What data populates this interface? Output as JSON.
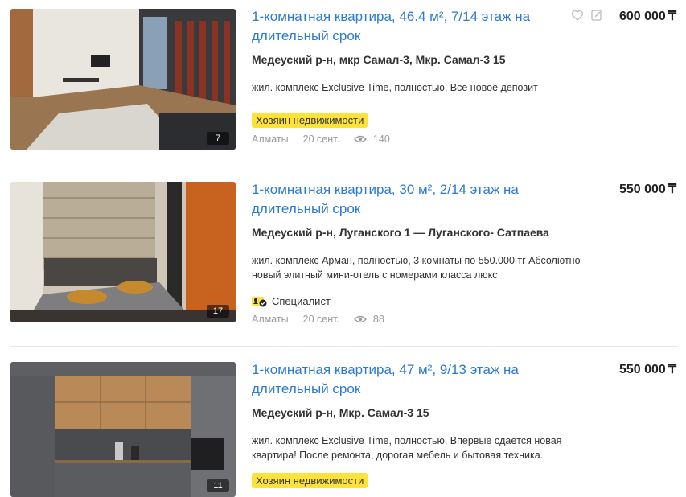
{
  "currency_symbol": "₸",
  "colors": {
    "link": "#2c7ad3",
    "tag": "#fde23b"
  },
  "listings": [
    {
      "title": "1-комнатная квартира, 46.4 м², 7/14 этаж на длительный срок",
      "price": "600 000",
      "address": "Медеуский р-н, мкр Самал-3, Мкр. Самал-3 15",
      "description": "жил. комплекс Exclusive Time, полностью, Все новое депозит",
      "tag": "Хозяин недвижимости",
      "city": "Алматы",
      "date": "20 сент.",
      "views": "140",
      "photo_count": "7",
      "icons": [
        "heart-icon",
        "note-icon",
        "eye-icon"
      ]
    },
    {
      "title": "1-комнатная квартира, 30 м², 2/14 этаж на длительный срок",
      "price": "550 000",
      "address": "Медеуский р-н, Луганского 1 — Луганского- Сатпаева",
      "description": "жил. комплекс Арман, полностью, 3 комнаты по 550.000 тг Абсолютно новый элитный мини-отель с номерами класса люкс",
      "badge": "Специалист",
      "city": "Алматы",
      "date": "20 сент.",
      "views": "88",
      "photo_count": "17",
      "icons": [
        "specialist-icon",
        "eye-icon"
      ]
    },
    {
      "title": "1-комнатная квартира, 47 м², 9/13 этаж на длительный срок",
      "price": "550 000",
      "address": "Медеуский р-н, Мкр. Самал-3 15",
      "description": "жил. комплекс Exclusive Time, полностью, Впервые сдаётся новая квартира! После ремонта, дорогая мебель и бытовая техника.",
      "tag": "Хозяин недвижимости",
      "photo_count": "11"
    }
  ]
}
